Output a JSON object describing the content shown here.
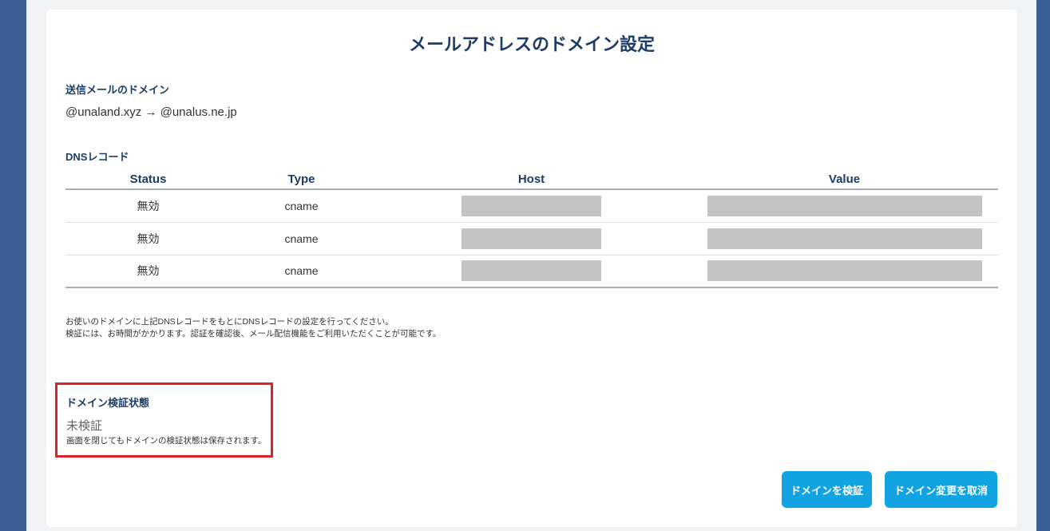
{
  "page": {
    "title": "メールアドレスのドメイン設定"
  },
  "sending_domain": {
    "label": "送信メールのドメイン",
    "value": "@unaland.xyz → @unalus.ne.jp"
  },
  "dns": {
    "label": "DNSレコード",
    "columns": [
      "Status",
      "Type",
      "Host",
      "Value"
    ],
    "rows": [
      {
        "status": "無効",
        "type": "cname"
      },
      {
        "status": "無効",
        "type": "cname"
      },
      {
        "status": "無効",
        "type": "cname"
      }
    ]
  },
  "notes": {
    "line1": "お使いのドメインに上記DNSレコードをもとにDNSレコードの設定を行ってください。",
    "line2": "検証には、お時間がかかります。認証を確認後、メール配信機能をご利用いただくことが可能です。"
  },
  "verification": {
    "heading": "ドメイン検証状態",
    "status": "未検証",
    "hint": "画面を閉じてもドメインの検証状態は保存されます。"
  },
  "buttons": {
    "verify": "ドメインを検証",
    "cancel": "ドメイン変更を取消"
  },
  "colors": {
    "accent": "#12a3e3",
    "heading": "#1c3d66",
    "highlight_border": "#e0202a",
    "background": "#3a5f96"
  }
}
